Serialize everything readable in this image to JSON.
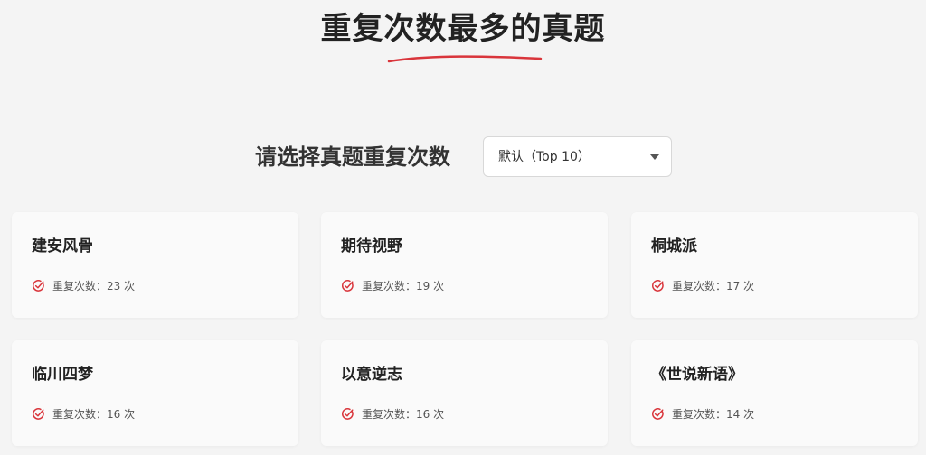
{
  "page": {
    "title": "重复次数最多的真题"
  },
  "filter": {
    "label": "请选择真题重复次数",
    "selected": "默认（Top 10）"
  },
  "colors": {
    "accent": "#d9353b",
    "background": "#f4f4f4",
    "card": "#fafafa"
  },
  "cards": [
    {
      "title": "建安风骨",
      "meta_label": "重复次数：",
      "count": "23 次",
      "icon": "check-circle-icon"
    },
    {
      "title": "期待视野",
      "meta_label": "重复次数：",
      "count": "19 次",
      "icon": "check-circle-icon"
    },
    {
      "title": "桐城派",
      "meta_label": "重复次数：",
      "count": "17 次",
      "icon": "check-circle-icon"
    },
    {
      "title": "临川四梦",
      "meta_label": "重复次数：",
      "count": "16 次",
      "icon": "check-circle-icon"
    },
    {
      "title": "以意逆志",
      "meta_label": "重复次数：",
      "count": "16 次",
      "icon": "check-circle-icon"
    },
    {
      "title": "《世说新语》",
      "meta_label": "重复次数：",
      "count": "14 次",
      "icon": "check-circle-icon"
    }
  ]
}
